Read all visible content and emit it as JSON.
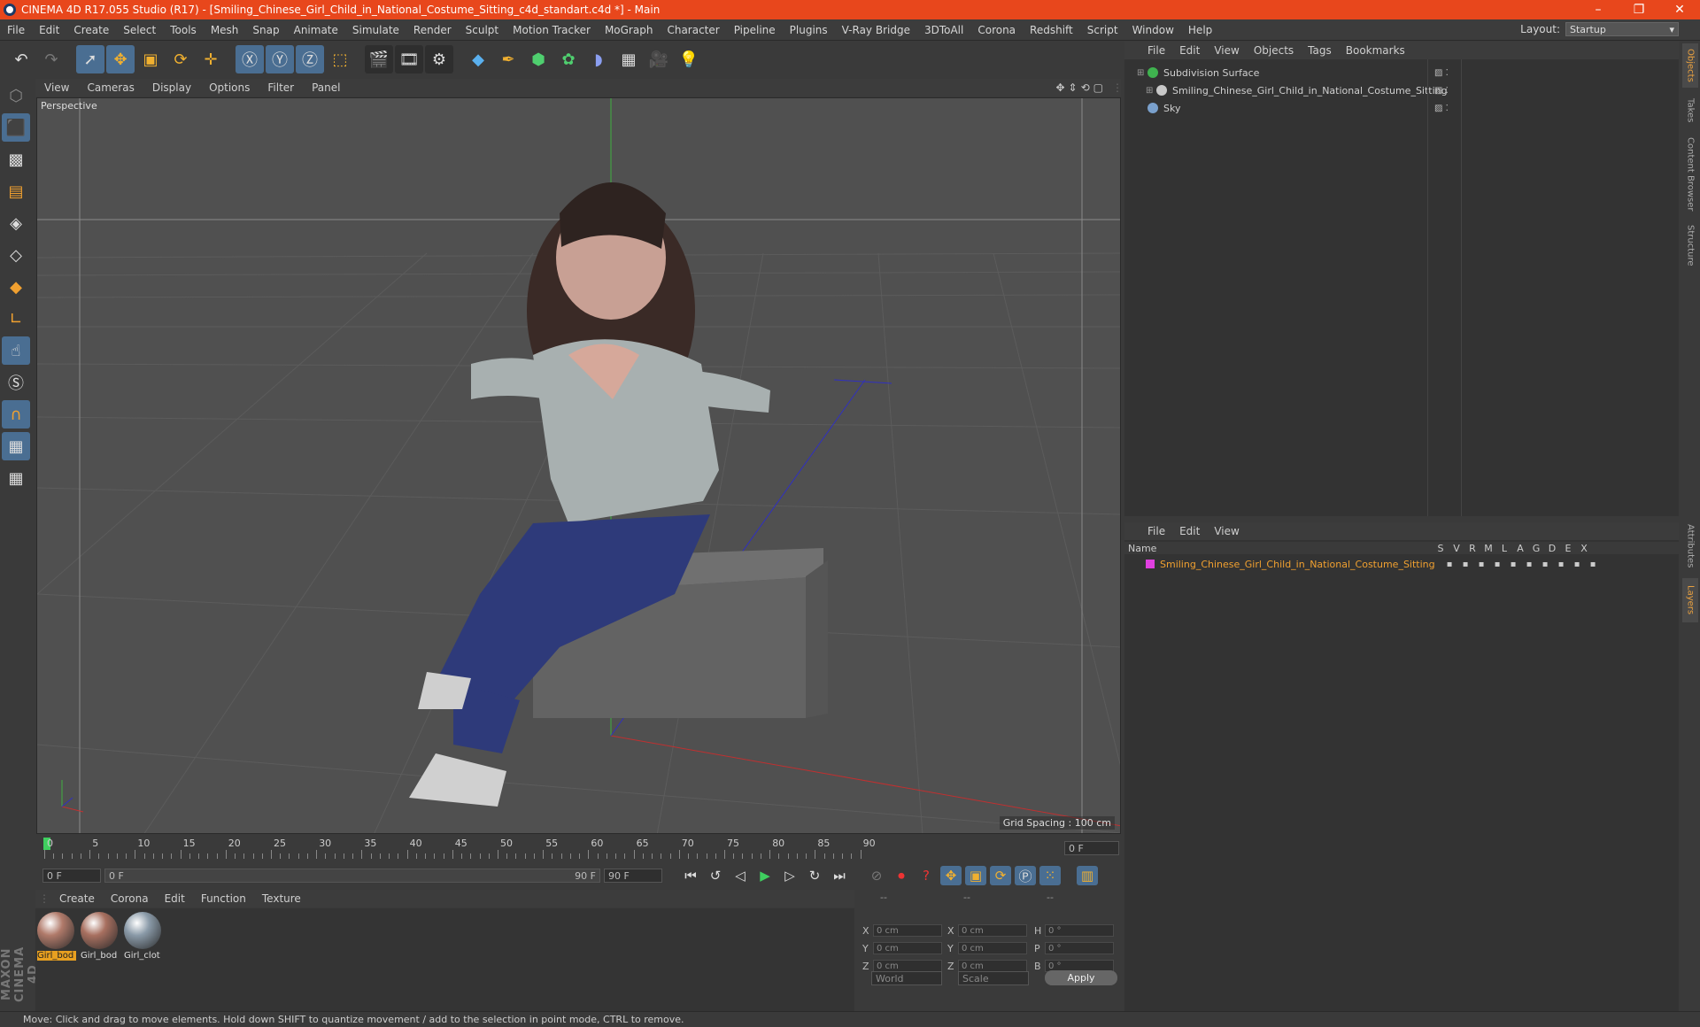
{
  "window": {
    "title": "CINEMA 4D R17.055 Studio (R17) - [Smiling_Chinese_Girl_Child_in_National_Costume_Sitting_c4d_standart.c4d *] - Main"
  },
  "menu": [
    "File",
    "Edit",
    "Create",
    "Select",
    "Tools",
    "Mesh",
    "Snap",
    "Animate",
    "Simulate",
    "Render",
    "Sculpt",
    "Motion Tracker",
    "MoGraph",
    "Character",
    "Pipeline",
    "Plugins",
    "V-Ray Bridge",
    "3DToAll",
    "Corona",
    "Redshift",
    "Script",
    "Window",
    "Help"
  ],
  "layout": {
    "label": "Layout:",
    "value": "Startup"
  },
  "viewport": {
    "menu": [
      "View",
      "Cameras",
      "Display",
      "Options",
      "Filter",
      "Panel"
    ],
    "label": "Perspective",
    "grid_spacing": "Grid Spacing : 100 cm"
  },
  "timeline": {
    "ticks": [
      "0",
      "5",
      "10",
      "15",
      "20",
      "25",
      "30",
      "35",
      "40",
      "45",
      "50",
      "55",
      "60",
      "65",
      "70",
      "75",
      "80",
      "85",
      "90"
    ],
    "current_frame": "0 F",
    "start_field": "0 F",
    "range_start": "0 F",
    "range_end": "90 F",
    "end_field": "90 F"
  },
  "materials": {
    "menu": [
      "Create",
      "Corona",
      "Edit",
      "Function",
      "Texture"
    ],
    "items": [
      {
        "label": "Girl_bod",
        "color": "#b07a6a"
      },
      {
        "label": "Girl_bod",
        "color": "#a87060"
      },
      {
        "label": "Girl_clot",
        "color": "#8a9aa8"
      }
    ]
  },
  "coords": {
    "header": [
      "--",
      "--",
      "--"
    ],
    "rows": [
      {
        "a": "X",
        "av": "0 cm",
        "b": "X",
        "bv": "0 cm",
        "c": "H",
        "cv": "0 °"
      },
      {
        "a": "Y",
        "av": "0 cm",
        "b": "Y",
        "bv": "0 cm",
        "c": "P",
        "cv": "0 °"
      },
      {
        "a": "Z",
        "av": "0 cm",
        "b": "Z",
        "bv": "0 cm",
        "c": "B",
        "cv": "0 °"
      }
    ],
    "world": "World",
    "scale": "Scale",
    "apply": "Apply"
  },
  "objects": {
    "menu": [
      "File",
      "Edit",
      "View",
      "Objects",
      "Tags",
      "Bookmarks"
    ],
    "items": [
      {
        "name": "Subdivision Surface",
        "icon_color": "#3fb34f"
      },
      {
        "name": "Smiling_Chinese_Girl_Child_in_National_Costume_Sitting",
        "icon_color": "#c8c8c8"
      },
      {
        "name": "Sky",
        "icon_color": "#7aa0cc"
      }
    ]
  },
  "layers": {
    "menu": [
      "File",
      "Edit",
      "View"
    ],
    "header": {
      "name": "Name",
      "cols": [
        "S",
        "V",
        "R",
        "M",
        "L",
        "A",
        "G",
        "D",
        "E",
        "X"
      ]
    },
    "items": [
      {
        "name": "Smiling_Chinese_Girl_Child_in_National_Costume_Sitting",
        "color": "#e040e0"
      }
    ]
  },
  "right_tabs": [
    "Objects",
    "Takes",
    "Content Browser",
    "Structure",
    "Attributes",
    "Layers"
  ],
  "status": "Move: Click and drag to move elements. Hold down SHIFT to quantize movement / add to the selection in point mode, CTRL to remove.",
  "brand": "MAXON CINEMA 4D",
  "colors": {
    "titlebar": "#e8471c",
    "accent_blue": "#4a6e92",
    "timeline_marker": "#3fcf5f"
  }
}
